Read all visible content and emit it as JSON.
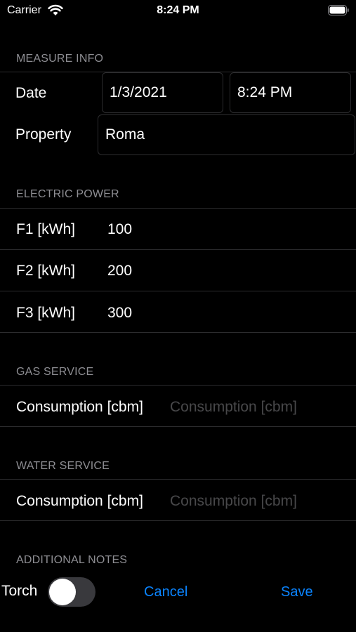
{
  "status_bar": {
    "carrier": "Carrier",
    "time": "8:24 PM"
  },
  "sections": {
    "measure_info": "MEASURE INFO",
    "electric_power": "ELECTRIC POWER",
    "gas_service": "GAS SERVICE",
    "water_service": "WATER SERVICE",
    "additional_notes": "ADDITIONAL NOTES"
  },
  "measure_info": {
    "date_label": "Date",
    "date_value": "1/3/2021",
    "time_value": "8:24 PM",
    "property_label": "Property",
    "property_value": "Roma"
  },
  "electric_power": {
    "f1_label": "F1 [kWh]",
    "f1_value": "100",
    "f2_label": "F2 [kWh]",
    "f2_value": "200",
    "f3_label": "F3 [kWh]",
    "f3_value": "300"
  },
  "gas_service": {
    "label": "Consumption [cbm]",
    "placeholder": "Consumption [cbm]"
  },
  "water_service": {
    "label": "Consumption [cbm]",
    "placeholder": "Consumption [cbm]"
  },
  "toolbar": {
    "torch_label": "Torch",
    "torch_on": false,
    "cancel_label": "Cancel",
    "save_label": "Save"
  }
}
